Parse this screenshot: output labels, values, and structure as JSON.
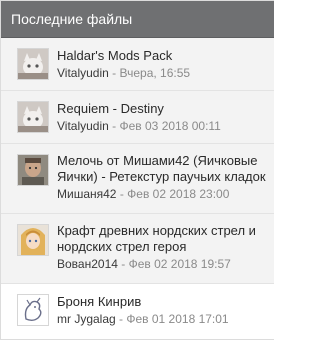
{
  "widget": {
    "title": "Последние файлы"
  },
  "files": [
    {
      "title": "Haldar's Mods Pack",
      "author": "Vitalyudin",
      "separator": " - ",
      "date": "Вчера, 16:55",
      "avatar_icon": "white-cat-avatar-icon"
    },
    {
      "title": "Requiem - Destiny",
      "author": "Vitalyudin",
      "separator": " - ",
      "date": "Фев 03 2018 00:11",
      "avatar_icon": "white-cat-avatar-icon"
    },
    {
      "title": "Мелочь от Мишами42 (Яичковые Яички) - Ретекстур паучьих кладок",
      "author": "Мишаня42",
      "separator": " - ",
      "date": "Фев 02 2018 23:00",
      "avatar_icon": "man-portrait-avatar-icon"
    },
    {
      "title": "Крафт древних нордских стрел и нордских стрел героя",
      "author": "Вован2014",
      "separator": " - ",
      "date": "Фев 02 2018 19:57",
      "avatar_icon": "anime-girl-avatar-icon"
    },
    {
      "title": "Броня Кинрив",
      "author": "mr Jygalag",
      "separator": " - ",
      "date": "Фев 01 2018 17:01",
      "avatar_icon": "dragon-sketch-avatar-icon"
    }
  ],
  "colors": {
    "header_bg": "#6f7072",
    "item_bg": "#f3f3f3",
    "meta_text": "#8a8a8a"
  }
}
